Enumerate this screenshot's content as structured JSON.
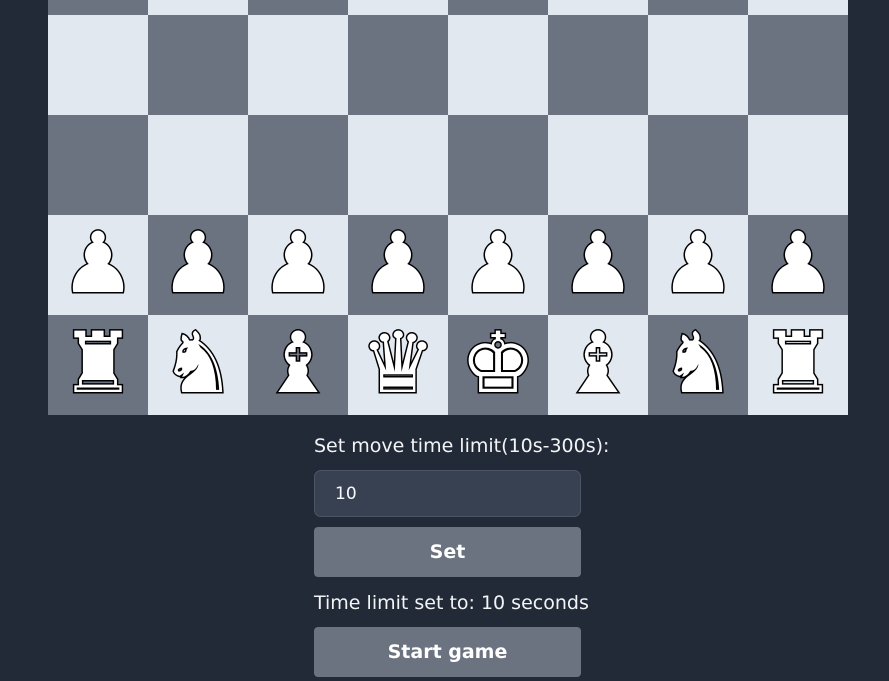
{
  "board": {
    "colors": {
      "light": "#e2e8f0",
      "dark": "#6b7280"
    },
    "rows": [
      {
        "pieces": [
          "",
          "",
          "",
          "",
          "",
          "",
          "",
          ""
        ]
      },
      {
        "pieces": [
          "",
          "",
          "",
          "",
          "",
          "",
          "",
          ""
        ]
      },
      {
        "pieces": [
          "",
          "",
          "",
          "",
          "",
          "",
          "",
          ""
        ]
      },
      {
        "pieces": [
          "♟",
          "♟",
          "♟",
          "♟",
          "♟",
          "♟",
          "♟",
          "♟"
        ],
        "names": [
          "white-pawn-icon",
          "white-pawn-icon",
          "white-pawn-icon",
          "white-pawn-icon",
          "white-pawn-icon",
          "white-pawn-icon",
          "white-pawn-icon",
          "white-pawn-icon"
        ]
      },
      {
        "pieces": [
          "♜",
          "♞",
          "♝",
          "♛",
          "♚",
          "♝",
          "♞",
          "♜"
        ],
        "names": [
          "white-rook-icon",
          "white-knight-icon",
          "white-bishop-icon",
          "white-queen-icon",
          "white-king-icon",
          "white-bishop-icon",
          "white-knight-icon",
          "white-rook-icon"
        ]
      }
    ]
  },
  "settings": {
    "time_label": "Set move time limit(10s-300s):",
    "time_value": "10",
    "set_label": "Set",
    "status_text": "Time limit set to: 10 seconds",
    "start_label": "Start game"
  }
}
